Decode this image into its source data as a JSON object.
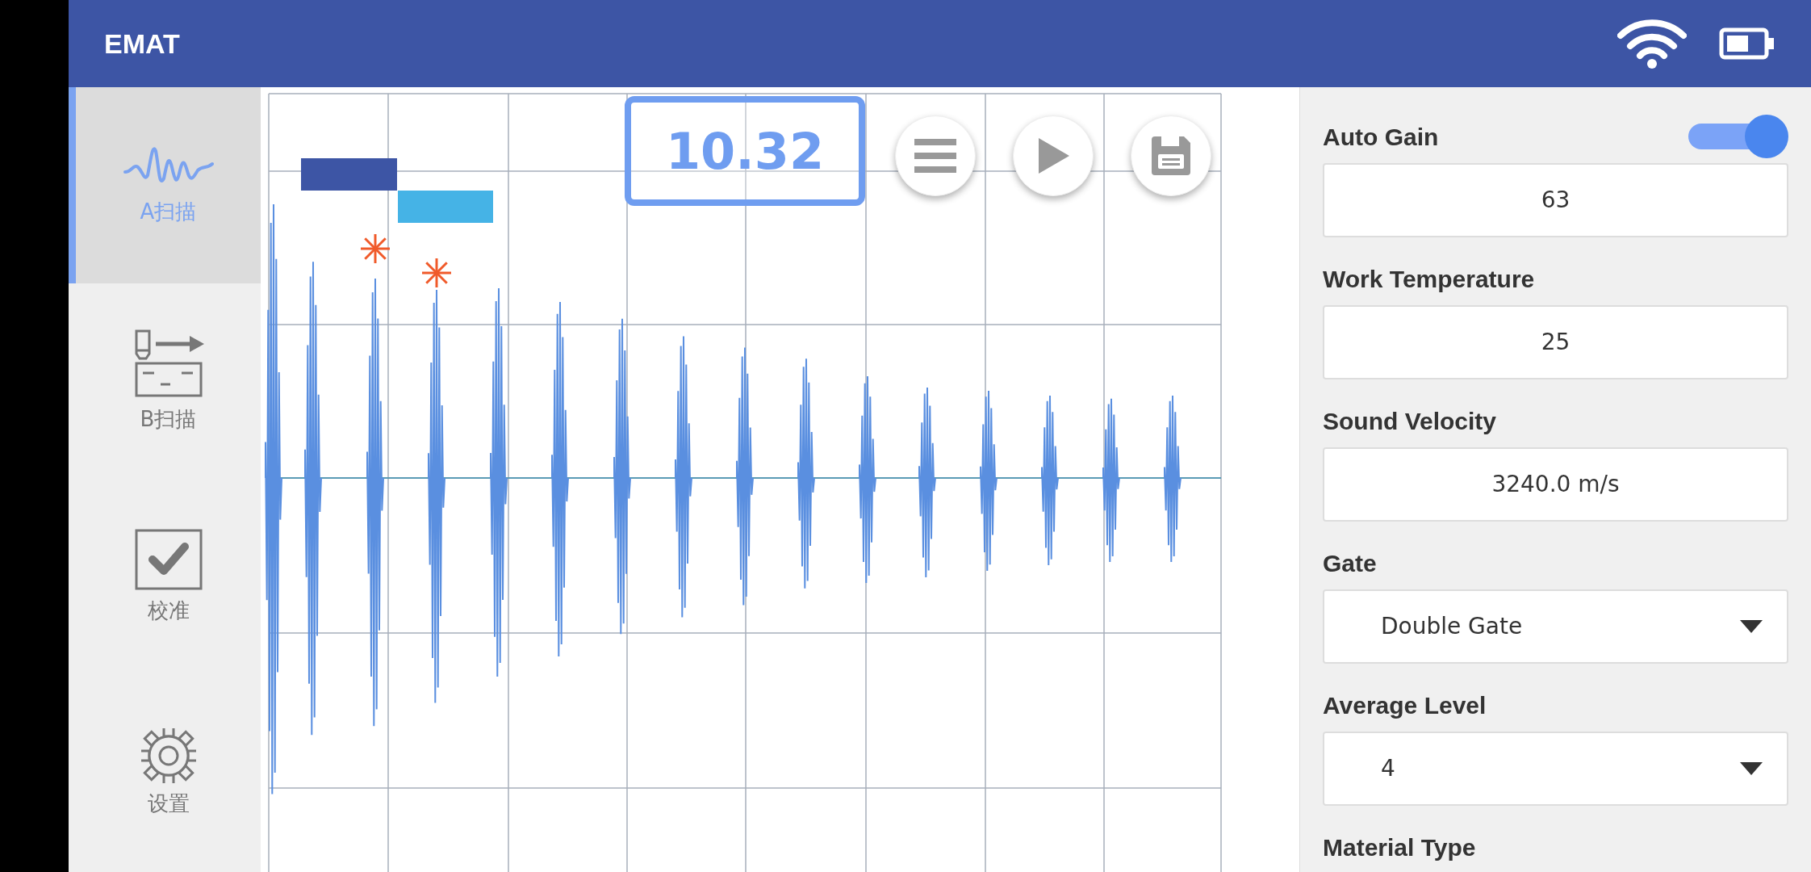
{
  "app_bar": {
    "title": "EMAT"
  },
  "nav": [
    {
      "label": "A扫描",
      "selected": true
    },
    {
      "label": "B扫描",
      "selected": false
    },
    {
      "label": "校准",
      "selected": false
    },
    {
      "label": "设置",
      "selected": false
    }
  ],
  "scan_view": {
    "reading": "10.32"
  },
  "settings": [
    {
      "kind": "toggle_input",
      "label": "Auto Gain",
      "on": true,
      "value": "63"
    },
    {
      "kind": "input",
      "label": "Work Temperature",
      "value": "25"
    },
    {
      "kind": "input",
      "label": "Sound Velocity",
      "value": "3240.0 m/s"
    },
    {
      "kind": "select",
      "label": "Gate",
      "value": "Double Gate"
    },
    {
      "kind": "select",
      "label": "Average Level",
      "value": "4"
    },
    {
      "kind": "label",
      "label": "Material Type"
    }
  ]
}
